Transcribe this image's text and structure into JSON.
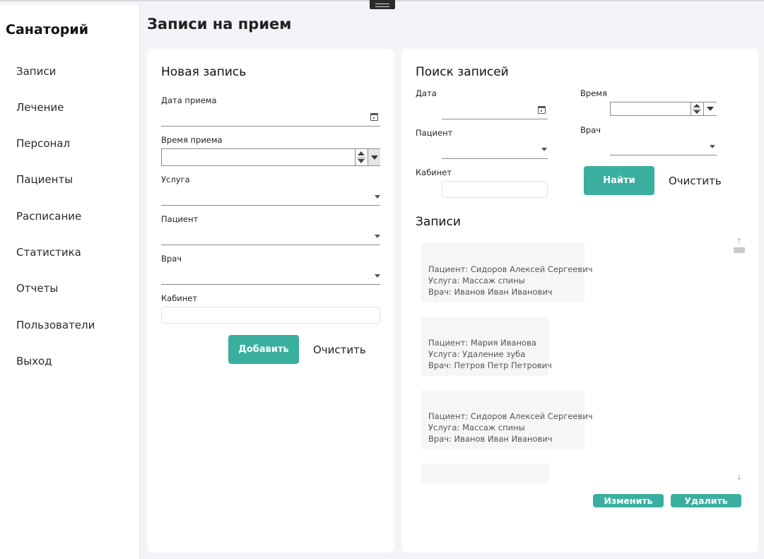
{
  "sidebar": {
    "brand": "Санаторий",
    "items": [
      {
        "label": "Записи"
      },
      {
        "label": "Лечение"
      },
      {
        "label": "Персонал"
      },
      {
        "label": "Пациенты"
      },
      {
        "label": "Расписание"
      },
      {
        "label": "Статистика"
      },
      {
        "label": "Отчеты"
      },
      {
        "label": "Пользователи"
      },
      {
        "label": "Выход"
      }
    ]
  },
  "page": {
    "title": "Записи на прием"
  },
  "new_record": {
    "title": "Новая запись",
    "date_label": "Дата приема",
    "date_value": "",
    "time_label": "Время приема",
    "time_value": "",
    "service_label": "Услуга",
    "patient_label": "Пациент",
    "doctor_label": "Врач",
    "cabinet_label": "Кабинет",
    "cabinet_value": "",
    "add_button": "Добавить",
    "clear_button": "Очистить"
  },
  "search": {
    "title": "Поиск записей",
    "date_label": "Дата",
    "time_label": "Время",
    "patient_label": "Пациент",
    "doctor_label": "Врач",
    "cabinet_label": "Кабинет",
    "cabinet_value": "",
    "find_button": "Найти",
    "clear_button": "Очистить"
  },
  "records": {
    "title": "Записи",
    "items": [
      {
        "patient": "Пациент: Сидоров Алексей Сергеевич",
        "service": "Услуга: Массаж спины",
        "doctor": "Врач: Иванов Иван Иванович"
      },
      {
        "patient": "Пациент: Мария Иванова",
        "service": "Услуга: Удаление зуба",
        "doctor": "Врач: Петров Петр Петрович"
      },
      {
        "patient": "Пациент: Сидоров Алексей Сергеевич",
        "service": "Услуга: Массаж спины",
        "doctor": "Врач: Иванов Иван Иванович"
      }
    ],
    "edit_button": "Изменить",
    "delete_button": "Удалить"
  },
  "colors": {
    "accent": "#3aafa0",
    "background": "#f3f4f8",
    "card": "#ffffff"
  }
}
